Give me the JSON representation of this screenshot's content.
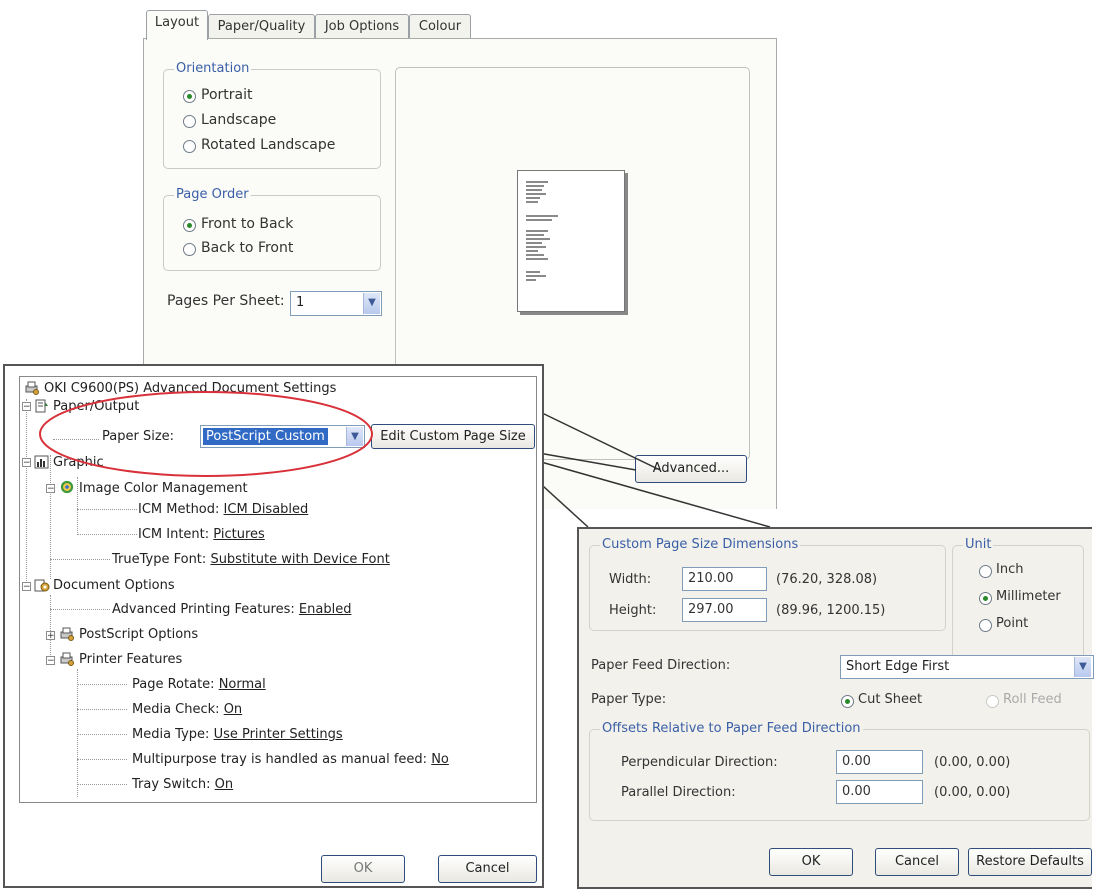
{
  "layout_dialog": {
    "tabs": [
      "Layout",
      "Paper/Quality",
      "Job Options",
      "Colour"
    ],
    "orientation": {
      "title": "Orientation",
      "options": [
        "Portrait",
        "Landscape",
        "Rotated Landscape"
      ],
      "selected": "Portrait"
    },
    "page_order": {
      "title": "Page Order",
      "options": [
        "Front to Back",
        "Back to Front"
      ],
      "selected": "Front to Back"
    },
    "pages_per_sheet": {
      "label": "Pages Per Sheet:",
      "value": "1"
    },
    "advanced_button": "Advanced..."
  },
  "advanced_settings": {
    "title": "OKI C9600(PS) Advanced Document Settings",
    "paper_output": "Paper/Output",
    "paper_size_label": "Paper Size:",
    "paper_size_value": "PostScript Custom",
    "edit_custom_button": "Edit Custom Page Size",
    "graphic": "Graphic",
    "image_color_management": "Image Color Management",
    "icm_method_label": "ICM Method:",
    "icm_method_value": "ICM Disabled",
    "icm_intent_label": "ICM Intent:",
    "icm_intent_value": "Pictures",
    "truetype_label": "TrueType Font:",
    "truetype_value": "Substitute with Device Font",
    "document_options": "Document Options",
    "adv_printing_label": "Advanced Printing Features:",
    "adv_printing_value": "Enabled",
    "postscript_options": "PostScript Options",
    "printer_features": "Printer Features",
    "page_rotate_label": "Page Rotate:",
    "page_rotate_value": "Normal",
    "media_check_label": "Media Check:",
    "media_check_value": "On",
    "media_type_label": "Media Type:",
    "media_type_value": "Use Printer Settings",
    "multipurpose_label": "Multipurpose tray is handled as manual feed:",
    "multipurpose_value": "No",
    "tray_switch_label": "Tray Switch:",
    "tray_switch_value": "On",
    "ok": "OK",
    "cancel": "Cancel"
  },
  "custom_page_size": {
    "dimensions_title": "Custom Page Size Dimensions",
    "width_label": "Width:",
    "width_value": "210.00",
    "width_range": "(76.20, 328.08)",
    "height_label": "Height:",
    "height_value": "297.00",
    "height_range": "(89.96, 1200.15)",
    "unit_title": "Unit",
    "units": [
      "Inch",
      "Millimeter",
      "Point"
    ],
    "unit_selected": "Millimeter",
    "feed_direction_label": "Paper Feed Direction:",
    "feed_direction_value": "Short Edge First",
    "paper_type_label": "Paper Type:",
    "paper_types": [
      "Cut Sheet",
      "Roll Feed"
    ],
    "paper_type_selected": "Cut Sheet",
    "offsets_title": "Offsets Relative to Paper Feed Direction",
    "perpendicular_label": "Perpendicular Direction:",
    "perpendicular_value": "0.00",
    "perpendicular_range": "(0.00, 0.00)",
    "parallel_label": "Parallel Direction:",
    "parallel_value": "0.00",
    "parallel_range": "(0.00, 0.00)",
    "ok": "OK",
    "cancel": "Cancel",
    "restore": "Restore Defaults"
  },
  "colors": {
    "highlight_circle": "#d9313a",
    "selection": "#316ac5",
    "group_title": "#3a5fa6"
  }
}
